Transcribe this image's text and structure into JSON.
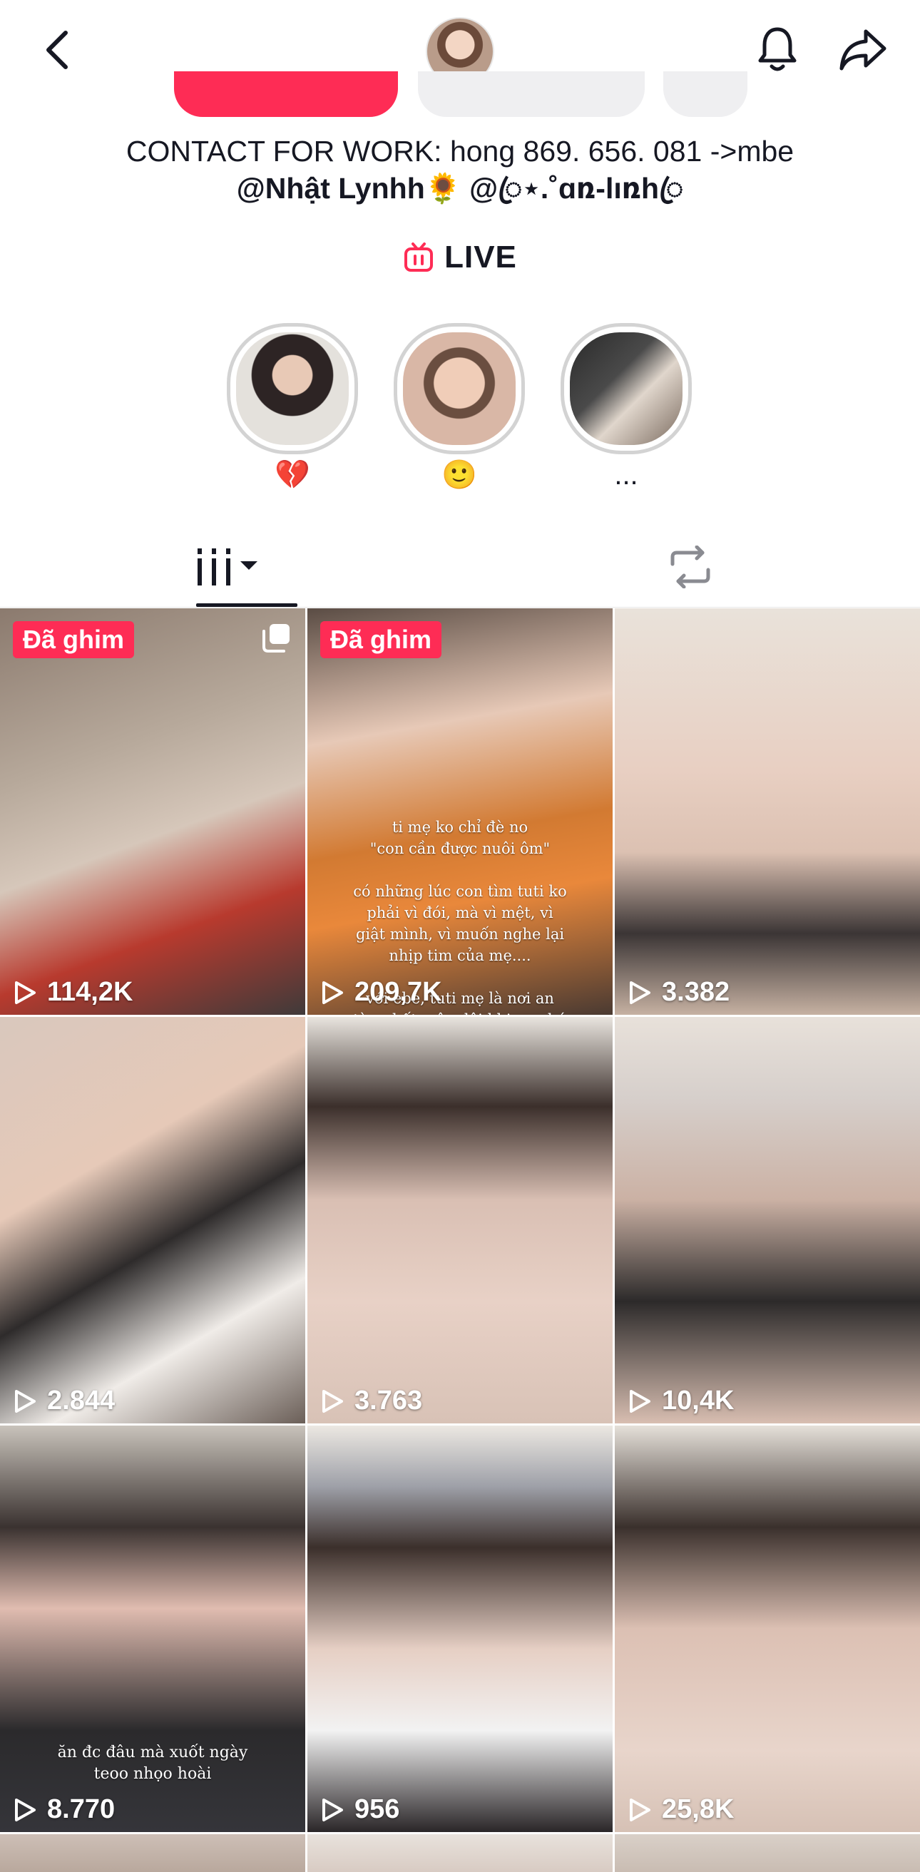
{
  "header": {
    "back_icon": "chevron-left-icon",
    "bell_icon": "bell-icon",
    "share_icon": "share-arrow-icon"
  },
  "bio": {
    "line1": "CONTACT FOR WORK: hong 869. 656. 081 ->mbe",
    "line2": "@Nhật Lynhh🌻 @ꦿ⋆.˚ɑռ-lıռhꦿ"
  },
  "live": {
    "label": "LIVE",
    "icon": "live-tv-icon",
    "color": "#fe2c55"
  },
  "highlights": [
    {
      "caption": "💔"
    },
    {
      "caption": "🙂"
    },
    {
      "caption": "..."
    }
  ],
  "tabs": {
    "videos_icon": "grid-bars-icon",
    "repost_icon": "repost-icon"
  },
  "videos": [
    {
      "pinned": "Đã ghim",
      "views": "114,2K",
      "multi_icon": "multi-photo-icon"
    },
    {
      "pinned": "Đã ghim",
      "views": "209,7K",
      "overlay": "ti mẹ ko chỉ đè no\n\"con cần được nuôi ôm\"\n\ncó những lúc con tìm tuti ko\nphải vì đói, mà vì mệt, vì\ngiật mình, vì muốn nghe lại\nnhịp tim của mẹ....\n\nvới ebe, tuti mẹ là nơi an\ntàn nhất, nên đôi khi con bú\nlật nhật....\n\nchỉ là vì"
    },
    {
      "views": "3.382"
    },
    {
      "views": "2.844"
    },
    {
      "views": "3.763"
    },
    {
      "views": "10,4K"
    },
    {
      "views": "8.770",
      "overlay": "ăn đc đâu mà xuốt ngày\nteoo nhọo hoài"
    },
    {
      "views": "956"
    },
    {
      "views": "25,8K"
    }
  ],
  "colors": {
    "accent": "#fe2c55",
    "text": "#161823",
    "button_grey": "#efeff1"
  }
}
